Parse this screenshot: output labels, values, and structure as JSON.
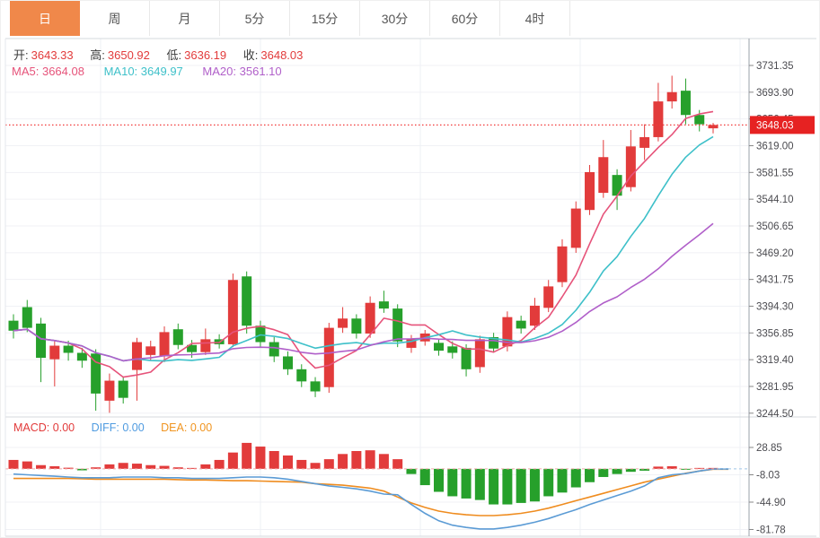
{
  "tabs": [
    {
      "label": "日",
      "active": true
    },
    {
      "label": "周",
      "active": false
    },
    {
      "label": "月",
      "active": false
    },
    {
      "label": "5分",
      "active": false
    },
    {
      "label": "15分",
      "active": false
    },
    {
      "label": "30分",
      "active": false
    },
    {
      "label": "60分",
      "active": false
    },
    {
      "label": "4时",
      "active": false
    }
  ],
  "header": {
    "open_label": "开:",
    "open": "3643.33",
    "high_label": "高:",
    "high": "3650.92",
    "low_label": "低:",
    "low": "3636.19",
    "close_label": "收:",
    "close": "3648.03"
  },
  "ma_header": [
    {
      "label": "MA5:",
      "value": "3664.08",
      "color": "#e6537a"
    },
    {
      "label": "MA10:",
      "value": "3649.97",
      "color": "#3ec0c9"
    },
    {
      "label": "MA20:",
      "value": "3561.10",
      "color": "#b05fc9"
    }
  ],
  "macd_header": [
    {
      "label": "MACD:",
      "value": "0.00",
      "color": "#e23b3b"
    },
    {
      "label": "DIFF:",
      "value": "0.00",
      "color": "#4f9be0"
    },
    {
      "label": "DEA:",
      "value": "0.00",
      "color": "#f0941f"
    }
  ],
  "price_axis": {
    "ticks": [
      "3731.35",
      "3693.90",
      "3656.45",
      "3619.00",
      "3581.55",
      "3544.10",
      "3506.65",
      "3469.20",
      "3431.75",
      "3394.30",
      "3356.85",
      "3319.40",
      "3281.95",
      "3244.50"
    ]
  },
  "macd_axis": {
    "ticks": [
      "28.85",
      "-8.03",
      "-44.90",
      "-81.78"
    ]
  },
  "last_price": {
    "label": "3648.03",
    "value": 3648.03
  },
  "chart_data": {
    "type": "candlestick+macd-histogram",
    "title": "",
    "legend": [
      "MA5",
      "MA10",
      "MA20",
      "MACD",
      "DIFF",
      "DEA"
    ],
    "price_range": [
      3244.5,
      3731.35
    ],
    "macd_range": [
      -81.78,
      28.85
    ],
    "grid": true,
    "up_color": "#e23b3b",
    "down_color": "#26a02b",
    "price_line_color": "#f23a3a",
    "badge_color": "#e62222",
    "ma_colors": [
      "#e6537a",
      "#3ec0c9",
      "#b05fc9"
    ],
    "ma_periods": [
      5,
      10,
      20
    ],
    "diff_color": "#5b9bd5",
    "dea_color": "#ef8c1f",
    "candles": [
      [
        3374,
        3383,
        3349,
        3360
      ],
      [
        3393,
        3403,
        3358,
        3364
      ],
      [
        3370,
        3378,
        3288,
        3322
      ],
      [
        3320,
        3346,
        3282,
        3339
      ],
      [
        3339,
        3346,
        3318,
        3329
      ],
      [
        3329,
        3336,
        3308,
        3318
      ],
      [
        3328,
        3334,
        3248,
        3272
      ],
      [
        3262,
        3300,
        3245,
        3290
      ],
      [
        3290,
        3296,
        3258,
        3266
      ],
      [
        3305,
        3350,
        3262,
        3344
      ],
      [
        3326,
        3346,
        3318,
        3338
      ],
      [
        3324,
        3366,
        3316,
        3358
      ],
      [
        3362,
        3370,
        3334,
        3340
      ],
      [
        3340,
        3347,
        3322,
        3330
      ],
      [
        3330,
        3363,
        3326,
        3348
      ],
      [
        3348,
        3355,
        3335,
        3341
      ],
      [
        3341,
        3440,
        3337,
        3431
      ],
      [
        3436,
        3443,
        3356,
        3367
      ],
      [
        3367,
        3374,
        3336,
        3344
      ],
      [
        3344,
        3351,
        3316,
        3324
      ],
      [
        3324,
        3331,
        3298,
        3306
      ],
      [
        3306,
        3313,
        3281,
        3289
      ],
      [
        3289,
        3295,
        3267,
        3275
      ],
      [
        3281,
        3371,
        3273,
        3364
      ],
      [
        3364,
        3393,
        3357,
        3377
      ],
      [
        3377,
        3383,
        3349,
        3356
      ],
      [
        3356,
        3408,
        3350,
        3399
      ],
      [
        3401,
        3416,
        3385,
        3391
      ],
      [
        3391,
        3397,
        3337,
        3345
      ],
      [
        3336,
        3354,
        3329,
        3349
      ],
      [
        3345,
        3361,
        3339,
        3356
      ],
      [
        3343,
        3349,
        3325,
        3332
      ],
      [
        3338,
        3345,
        3321,
        3329
      ],
      [
        3336,
        3341,
        3296,
        3306
      ],
      [
        3309,
        3353,
        3301,
        3348
      ],
      [
        3351,
        3357,
        3329,
        3335
      ],
      [
        3338,
        3387,
        3331,
        3379
      ],
      [
        3374,
        3381,
        3356,
        3363
      ],
      [
        3367,
        3406,
        3361,
        3395
      ],
      [
        3392,
        3431,
        3386,
        3422
      ],
      [
        3428,
        3488,
        3421,
        3478
      ],
      [
        3476,
        3541,
        3469,
        3531
      ],
      [
        3529,
        3592,
        3522,
        3582
      ],
      [
        3553,
        3627,
        3546,
        3603
      ],
      [
        3578,
        3586,
        3529,
        3549
      ],
      [
        3561,
        3641,
        3555,
        3618
      ],
      [
        3616,
        3649,
        3599,
        3631
      ],
      [
        3631,
        3707,
        3625,
        3681
      ],
      [
        3681,
        3717,
        3671,
        3694
      ],
      [
        3696,
        3713,
        3649,
        3662
      ],
      [
        3662,
        3669,
        3639,
        3649
      ],
      [
        3643.33,
        3650.92,
        3636.19,
        3648.03
      ]
    ],
    "macd": {
      "hist": [
        12,
        10,
        5,
        3.5,
        1.5,
        -2,
        2,
        6,
        8,
        7,
        5,
        4,
        2,
        1,
        6,
        12,
        22,
        35,
        30,
        24,
        18,
        12,
        8,
        13,
        20,
        24,
        25,
        20,
        13,
        -7,
        -22,
        -31,
        -37,
        -40,
        -42,
        -48,
        -48,
        -46,
        -44,
        -37,
        -32,
        -25,
        -18,
        -11,
        -7,
        -4,
        -2.5,
        3,
        3.5,
        -1,
        0.4,
        0.2
      ],
      "diff": [
        -7,
        -8,
        -9,
        -10,
        -11,
        -12,
        -12,
        -12,
        -11,
        -11,
        -11,
        -12,
        -12,
        -13,
        -13,
        -13,
        -12,
        -11,
        -11,
        -12,
        -14,
        -17,
        -20,
        -23,
        -25,
        -27,
        -30,
        -34,
        -35,
        -48,
        -60,
        -70,
        -76,
        -79,
        -81,
        -81,
        -79,
        -76,
        -72,
        -67,
        -61,
        -55,
        -48,
        -42,
        -36,
        -30,
        -23,
        -12,
        -8,
        -6.5,
        -3,
        -0.3
      ],
      "dea": [
        -13,
        -13,
        -13,
        -13,
        -13,
        -13.5,
        -14,
        -14,
        -14,
        -14,
        -14,
        -14,
        -14.5,
        -15,
        -15,
        -15.5,
        -16,
        -16,
        -16.5,
        -17,
        -17.5,
        -18,
        -20,
        -21,
        -22,
        -24,
        -26,
        -30,
        -38,
        -46,
        -52,
        -57,
        -60,
        -62,
        -63,
        -63,
        -62,
        -60,
        -57,
        -53,
        -48,
        -43,
        -38,
        -33,
        -28,
        -23,
        -18,
        -14,
        -10,
        -6,
        -3,
        -0.5
      ]
    }
  }
}
